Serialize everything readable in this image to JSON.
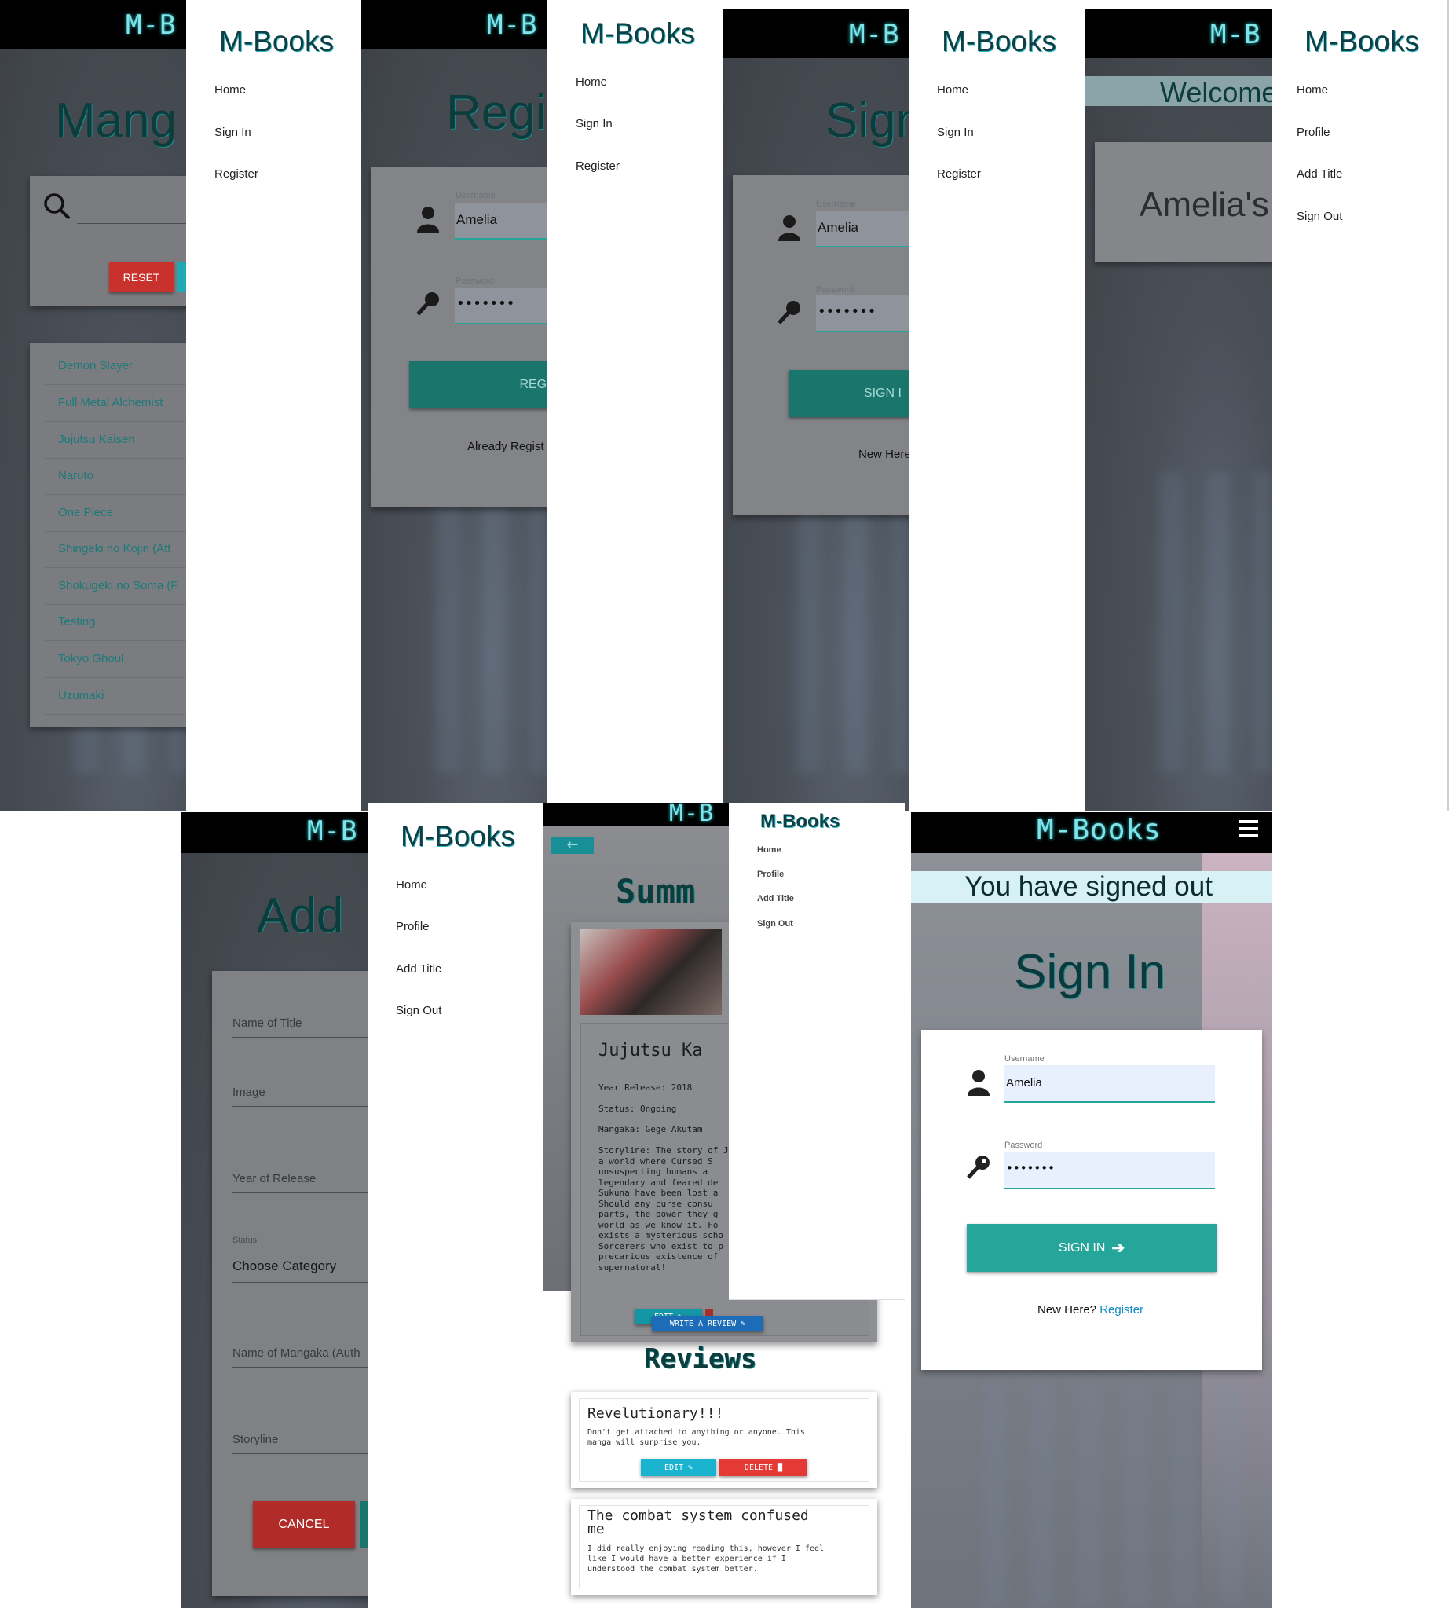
{
  "app_name": "M-Books",
  "logo_truncated": "M-B",
  "nav_guest": [
    "Home",
    "Sign In",
    "Register"
  ],
  "nav_user": [
    "Home",
    "Profile",
    "Add Title",
    "Sign Out"
  ],
  "panel1": {
    "heading": "Mang",
    "reset_label": "RESET",
    "titles": [
      "Demon Slayer",
      "Full Metal Alchemist",
      "Jujutsu Kaisen",
      "Naruto",
      "One Piece",
      "Shingeki no Kojin (Att",
      "Shokugeki no Soma (F",
      "Testing",
      "Tokyo Ghoul",
      "Uzumaki"
    ]
  },
  "panel2": {
    "heading": "Regi",
    "username_label": "Username",
    "username_value": "Amelia",
    "password_label": "Password",
    "password_value": "•••••••",
    "submit_label": "REGIST",
    "footer_text": "Already Regist"
  },
  "panel3": {
    "heading": "Sign",
    "username_label": "Username",
    "username_value": "Amelia",
    "password_label": "Password",
    "password_value": "•••••••",
    "submit_label": "SIGN I",
    "footer_text": "New Here?"
  },
  "panel4": {
    "banner": "Welcome",
    "card_title": "Amelia's"
  },
  "panel5": {
    "heading": "Add",
    "fields": [
      "Name of Title",
      "Image",
      "Year of Release",
      "Choose Category",
      "Name of Mangaka (Auth",
      "Storyline"
    ],
    "status_label": "Status",
    "cancel_label": "CANCEL"
  },
  "panel6": {
    "back_label": "←",
    "heading": "Summ",
    "book_title": "Jujutsu Ka",
    "year_release": "Year Release: 2018",
    "status": "Status: Ongoing",
    "mangaka": "Mangaka: Gege Akutam",
    "storyline": [
      "Storyline: The story of J",
      "a world where Cursed S",
      "unsuspecting humans a",
      "legendary and feared de",
      "Sukuna have been lost a",
      "Should any curse consu",
      "parts, the power they g",
      "world as we know it. Fo",
      "exists a mysterious scho",
      "Sorcerers who exist to p",
      "precarious existence of",
      "supernatural!"
    ],
    "edit_label": "EDIT",
    "write_review_label": "WRITE A REVIEW",
    "reviews_heading": "Reviews",
    "reviews": [
      {
        "title": "Revelutionary!!!",
        "body": [
          "Don't get attached to anything or anyone. This",
          "manga will surprise you."
        ],
        "edit": "EDIT",
        "delete": "DELETE"
      },
      {
        "title": "The combat system confused",
        "title2": "me",
        "body": [
          "I did really enjoying reading this, however I feel",
          "like I would have a better experience if I",
          "understood the combat system better."
        ]
      }
    ]
  },
  "panel7": {
    "banner": "You have signed out",
    "heading": "Sign In",
    "username_label": "Username",
    "username_value": "Amelia",
    "password_label": "Password",
    "password_value": "•••••••",
    "submit_label": "SIGN IN",
    "footer_text": "New Here?",
    "footer_link": "Register"
  },
  "colors": {
    "teal": "#26a69a",
    "red": "#e53935",
    "cyan": "#00bcd4",
    "blue": "#1e88e5",
    "heading_dark": "#0d3c3c"
  }
}
